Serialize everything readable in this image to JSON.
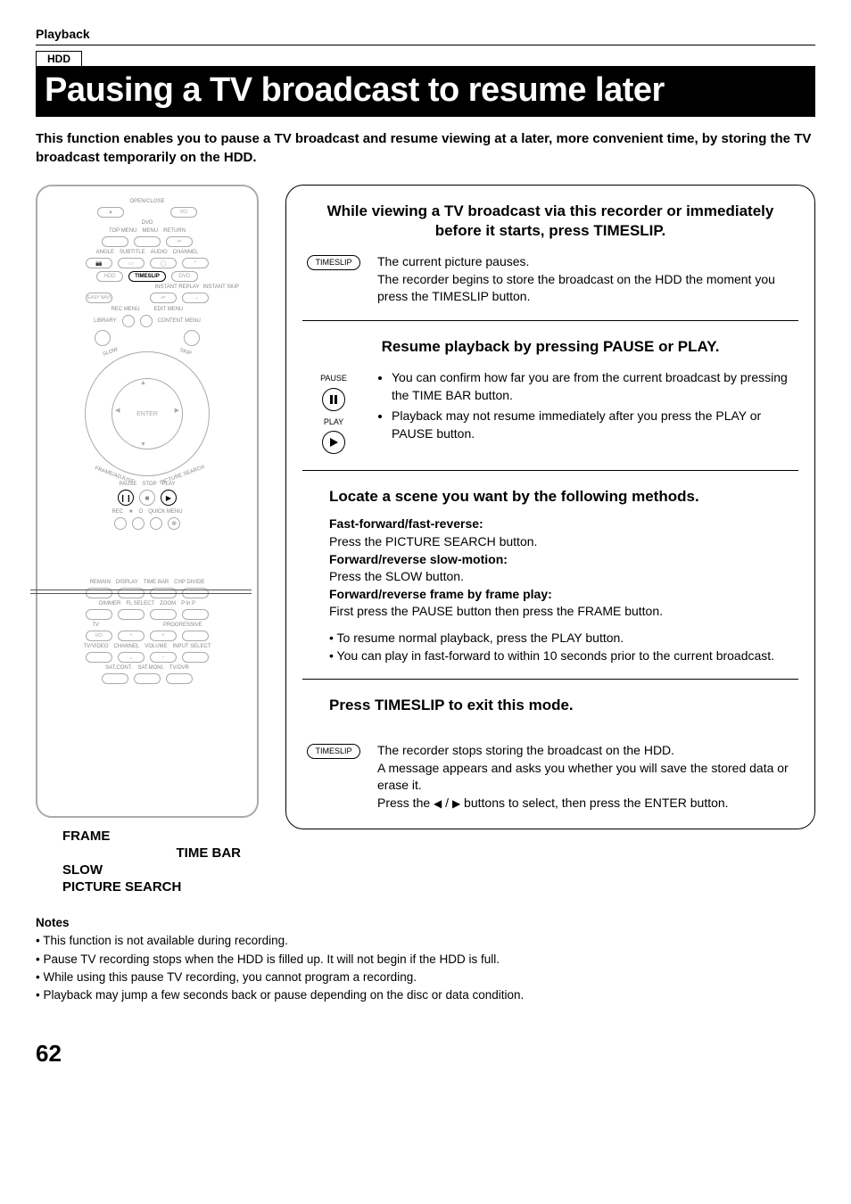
{
  "header": {
    "section": "Playback",
    "badge": "HDD",
    "title": "Pausing a TV broadcast to resume later",
    "intro": "This function enables you to pause a TV broadcast and resume viewing at a later, more convenient time, by storing the TV broadcast temporarily on the HDD."
  },
  "remote_labels": {
    "open_close": "OPEN/CLOSE",
    "dvd": "DVD",
    "top_menu": "TOP MENU",
    "menu": "MENU",
    "return": "RETURN",
    "angle": "ANGLE",
    "subtitle": "SUBTITLE",
    "audio": "AUDIO",
    "channel": "CHANNEL",
    "hdd": "HDD",
    "timeslip": "TIMESLIP",
    "dvd2": "DVD",
    "easy_navi": "EASY NAVI",
    "instant_replay": "INSTANT REPLAY",
    "instant_skip": "INSTANT SKIP",
    "rec_menu": "REC MENU",
    "edit_menu": "EDIT MENU",
    "library": "LIBRARY",
    "content_menu": "CONTENT MENU",
    "enter": "ENTER",
    "slow": "SLOW",
    "skip": "SKIP",
    "frame": "FRAME",
    "adjust": "ADJUST",
    "picture_search": "PICTURE SEARCH",
    "pause": "PAUSE",
    "stop": "STOP",
    "play": "PLAY",
    "rec": "REC",
    "star": "★",
    "circle": "O",
    "quick_menu": "QUICK MENU",
    "remain": "REMAIN",
    "display": "DISPLAY",
    "time_bar": "TIME BAR",
    "chp_divide": "CHP DIVIDE",
    "dimmer": "DIMMER",
    "fl_select": "FL SELECT",
    "zoom": "ZOOM",
    "pinp": "P in P",
    "tv": "TV",
    "progressive": "PROGRESSIVE",
    "tv_video": "TV/VIDEO",
    "channel2": "CHANNEL",
    "volume": "VOLUME",
    "input_select": "INPUT SELECT",
    "sat_cont": "SAT.CONT.",
    "sat_moni": "SAT.MONI.",
    "tv_dvr": "TV/DVR"
  },
  "callouts": {
    "frame": "FRAME",
    "slow": "SLOW",
    "time_bar": "TIME BAR",
    "picture_search": "PICTURE SEARCH"
  },
  "step1": {
    "heading": "While viewing a TV broadcast via this recorder or immediately before it starts, press TIMESLIP.",
    "btn": "TIMESLIP",
    "p1": "The current picture pauses.",
    "p2": "The recorder begins to store the broadcast on the HDD the moment you press the TIMESLIP button."
  },
  "step2": {
    "heading": "Resume playback by pressing PAUSE or PLAY.",
    "btn_pause_label": "PAUSE",
    "btn_play_label": "PLAY",
    "li1": "You can confirm how far you are from the current broadcast by pressing the TIME BAR button.",
    "li2": "Playback may not resume immediately after you press the PLAY or PAUSE button."
  },
  "step3": {
    "heading": "Locate a scene you want by the following methods.",
    "ff_label": "Fast-forward/fast-reverse:",
    "ff_text": "Press the PICTURE SEARCH button.",
    "slow_label": "Forward/reverse slow-motion:",
    "slow_text": "Press the SLOW button.",
    "frame_label": "Forward/reverse frame by frame play:",
    "frame_text": "First press the PAUSE button then press the FRAME button.",
    "resume": "To resume normal playback, press the PLAY button.",
    "ff_note": "You can play in fast-forward to within 10 seconds prior to the current broadcast."
  },
  "step4": {
    "heading": "Press TIMESLIP to exit this mode.",
    "btn": "TIMESLIP",
    "p1": "The recorder stops storing the broadcast on the HDD.",
    "p2": "A message appears and asks you whether you will save the stored data or erase it.",
    "p3a": "Press the ",
    "p3b": " buttons to select, then press the ENTER button."
  },
  "notes": {
    "title": "Notes",
    "n1": "This function is not available during recording.",
    "n2": "Pause TV recording stops when the HDD is filled up. It will not begin if the HDD is full.",
    "n3": "While using this pause TV recording, you cannot program a recording.",
    "n4": "Playback may jump a few seconds back or pause depending on the disc or data condition."
  },
  "page_number": "62"
}
